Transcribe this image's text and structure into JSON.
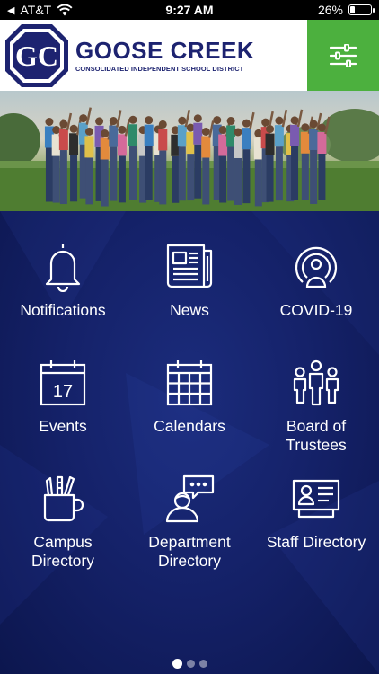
{
  "status_bar": {
    "carrier": "AT&T",
    "time": "9:27 AM",
    "battery": "26%",
    "battery_level": 0.26
  },
  "header": {
    "logo_letters": "GC",
    "name": "GOOSE CREEK",
    "subtitle": "CONSOLIDATED INDEPENDENT SCHOOL DISTRICT",
    "menu_icon": "sliders-icon",
    "colors": {
      "brand": "#1d2370",
      "menu_bg": "#4cb03e"
    }
  },
  "tiles": [
    {
      "label": "Notifications",
      "icon": "bell-icon"
    },
    {
      "label": "News",
      "icon": "newspaper-icon"
    },
    {
      "label": "COVID-19",
      "icon": "broadcast-person-icon"
    },
    {
      "label": "Events",
      "icon": "calendar-day-icon",
      "icon_text": "17"
    },
    {
      "label": "Calendars",
      "icon": "calendar-grid-icon"
    },
    {
      "label": "Board of\nTrustees",
      "icon": "group-icon"
    },
    {
      "label": "Campus\nDirectory",
      "icon": "supplies-cup-icon"
    },
    {
      "label": "Department\nDirectory",
      "icon": "person-speech-icon"
    },
    {
      "label": "Staff Directory",
      "icon": "id-card-icon"
    }
  ],
  "pager": {
    "pages": 3,
    "current": 1
  },
  "colors": {
    "background": "#15226a",
    "text": "#ffffff"
  }
}
